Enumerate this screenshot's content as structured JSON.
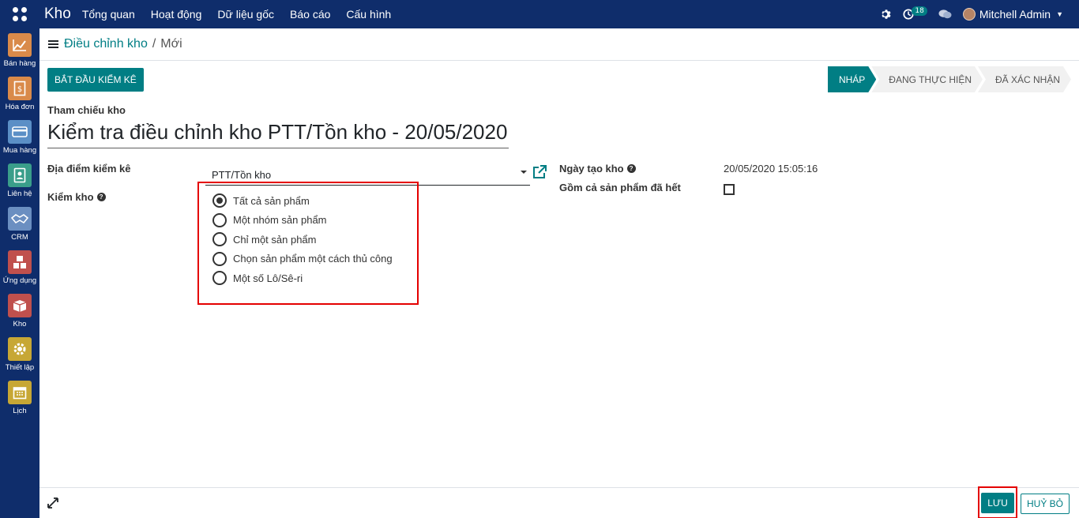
{
  "app": {
    "name": "Kho"
  },
  "menu": [
    "Tổng quan",
    "Hoạt động",
    "Dữ liệu gốc",
    "Báo cáo",
    "Cấu hình"
  ],
  "topbar": {
    "activity_count": "18",
    "user_name": "Mitchell Admin"
  },
  "sidebar": {
    "items": [
      {
        "label": "Bán hàng",
        "icon": "sales-chart-icon",
        "color": "#d98a4a"
      },
      {
        "label": "Hóa đơn",
        "icon": "invoice-icon",
        "color": "#d98a4a"
      },
      {
        "label": "Mua hàng",
        "icon": "purchase-card-icon",
        "color": "#5b8fc6"
      },
      {
        "label": "Liên hệ",
        "icon": "contacts-icon",
        "color": "#3a9e8a"
      },
      {
        "label": "CRM",
        "icon": "handshake-icon",
        "color": "#6b8fc1"
      },
      {
        "label": "Ứng dụng",
        "icon": "apps-cubes-icon",
        "color": "#c0504d"
      },
      {
        "label": "Kho",
        "icon": "inventory-box-icon",
        "color": "#c0504d"
      },
      {
        "label": "Thiết lập",
        "icon": "settings-gear-icon",
        "color": "#c7a735"
      },
      {
        "label": "Lịch",
        "icon": "calendar-icon",
        "color": "#c7a735"
      }
    ]
  },
  "breadcrumb": {
    "parent": "Điều chỉnh kho",
    "separator": "/",
    "current": "Mới"
  },
  "header": {
    "start_button": "BẮT ĐẦU KIỂM KÊ",
    "stages": [
      {
        "label": "NHÁP",
        "active": true
      },
      {
        "label": "ĐANG THỰC HIỆN",
        "active": false
      },
      {
        "label": "ĐÃ XÁC NHẬN",
        "active": false
      }
    ]
  },
  "form": {
    "ref_label": "Tham chiếu kho",
    "ref_value": "Kiểm tra điều chỉnh kho PTT/Tồn kho - 20/05/2020",
    "location_label": "Địa điểm kiểm kê",
    "location_value": "PTT/Tồn kho",
    "inventory_label": "Kiểm kho",
    "inventory_options": [
      {
        "label": "Tất cả sản phẩm",
        "checked": true
      },
      {
        "label": "Một nhóm sản phẩm",
        "checked": false
      },
      {
        "label": "Chỉ một sản phẩm",
        "checked": false
      },
      {
        "label": "Chọn sản phẩm một cách thủ công",
        "checked": false
      },
      {
        "label": "Một số Lô/Sê-ri",
        "checked": false
      }
    ],
    "date_label": "Ngày tạo kho",
    "date_value": "20/05/2020 15:05:16",
    "exhausted_label": "Gồm cả sản phẩm đã hết",
    "exhausted_checked": false
  },
  "footer": {
    "save_label": "LƯU",
    "discard_label": "HUỶ BỎ"
  },
  "colors": {
    "navbar": "#0f2d6b",
    "primary": "#017e84",
    "highlight_border": "#e40000"
  }
}
